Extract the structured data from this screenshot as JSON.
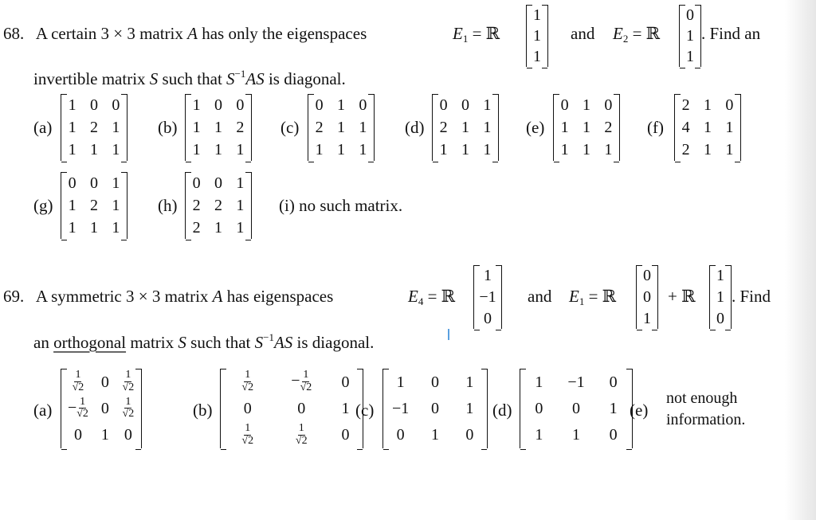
{
  "problem68": {
    "number": "68.",
    "text1": "A certain 3 × 3 matrix",
    "A": "A",
    "text2": "has only the eigenspaces",
    "E1_label": "E",
    "E1_sub": "1",
    "eq": "= ℝ",
    "E1_vector": [
      "1",
      "1",
      "1"
    ],
    "and": "and",
    "E2_label": "E",
    "E2_sub": "2",
    "E2_vector": [
      "0",
      "1",
      "1"
    ],
    "tail": ". Find an",
    "line2_a": "invertible matrix",
    "S": "S",
    "line2_b": "such that",
    "S_inv": "S",
    "inv_sup": "−1",
    "AS": "AS",
    "line2_c": "is diagonal.",
    "options": [
      {
        "label": "(a)",
        "matrix": [
          [
            "1",
            "0",
            "0"
          ],
          [
            "1",
            "2",
            "1"
          ],
          [
            "1",
            "1",
            "1"
          ]
        ]
      },
      {
        "label": "(b)",
        "matrix": [
          [
            "1",
            "0",
            "0"
          ],
          [
            "1",
            "1",
            "2"
          ],
          [
            "1",
            "1",
            "1"
          ]
        ]
      },
      {
        "label": "(c)",
        "matrix": [
          [
            "0",
            "1",
            "0"
          ],
          [
            "2",
            "1",
            "1"
          ],
          [
            "1",
            "1",
            "1"
          ]
        ]
      },
      {
        "label": "(d)",
        "matrix": [
          [
            "0",
            "0",
            "1"
          ],
          [
            "2",
            "1",
            "1"
          ],
          [
            "1",
            "1",
            "1"
          ]
        ]
      },
      {
        "label": "(e)",
        "matrix": [
          [
            "0",
            "1",
            "0"
          ],
          [
            "1",
            "1",
            "2"
          ],
          [
            "1",
            "1",
            "1"
          ]
        ]
      },
      {
        "label": "(f)",
        "matrix": [
          [
            "2",
            "1",
            "0"
          ],
          [
            "4",
            "1",
            "1"
          ],
          [
            "2",
            "1",
            "1"
          ]
        ]
      },
      {
        "label": "(g)",
        "matrix": [
          [
            "0",
            "0",
            "1"
          ],
          [
            "1",
            "2",
            "1"
          ],
          [
            "1",
            "1",
            "1"
          ]
        ]
      },
      {
        "label": "(h)",
        "matrix": [
          [
            "0",
            "0",
            "1"
          ],
          [
            "2",
            "2",
            "1"
          ],
          [
            "2",
            "1",
            "1"
          ]
        ]
      }
    ],
    "option_i": {
      "label": "(i)",
      "text": "no such matrix."
    }
  },
  "problem69": {
    "number": "69.",
    "text1": "A symmetric 3 × 3 matrix",
    "A": "A",
    "text2": "has eigenspaces",
    "E4_label": "E",
    "E4_sub": "4",
    "eq": "= ℝ",
    "E4_vector": [
      "1",
      "−1",
      "0"
    ],
    "and": "and",
    "E1_label": "E",
    "E1_sub": "1",
    "E1_vector_a": [
      "0",
      "0",
      "1"
    ],
    "plus": "+ ℝ",
    "E1_vector_b": [
      "1",
      "1",
      "0"
    ],
    "tail": ". Find",
    "line2_a": "an",
    "orthogonal": "orthogonal",
    "line2_b": "matrix",
    "S": "S",
    "line2_c": "such that",
    "S_inv": "S",
    "inv_sup": "−1",
    "AS": "AS",
    "line2_d": "is diagonal.",
    "frac_num": "1",
    "frac_den": "√2",
    "options": [
      {
        "label": "(a)",
        "matrix": [
          [
            "f",
            "0",
            "f"
          ],
          [
            "-f",
            "0",
            "f"
          ],
          [
            "0",
            "1",
            "0"
          ]
        ]
      },
      {
        "label": "(b)",
        "matrix": [
          [
            "f",
            "-f",
            "0"
          ],
          [
            "0",
            "0",
            "1"
          ],
          [
            "f",
            "f",
            "0"
          ]
        ]
      },
      {
        "label": "(c)",
        "matrix": [
          [
            "1",
            "0",
            "1"
          ],
          [
            "−1",
            "0",
            "1"
          ],
          [
            "0",
            "1",
            "0"
          ]
        ]
      },
      {
        "label": "(d)",
        "matrix": [
          [
            "1",
            "−1",
            "0"
          ],
          [
            "0",
            "0",
            "1"
          ],
          [
            "1",
            "1",
            "0"
          ]
        ]
      }
    ],
    "option_e": {
      "label": "(e)",
      "line1": "not enough",
      "line2": "information."
    }
  }
}
